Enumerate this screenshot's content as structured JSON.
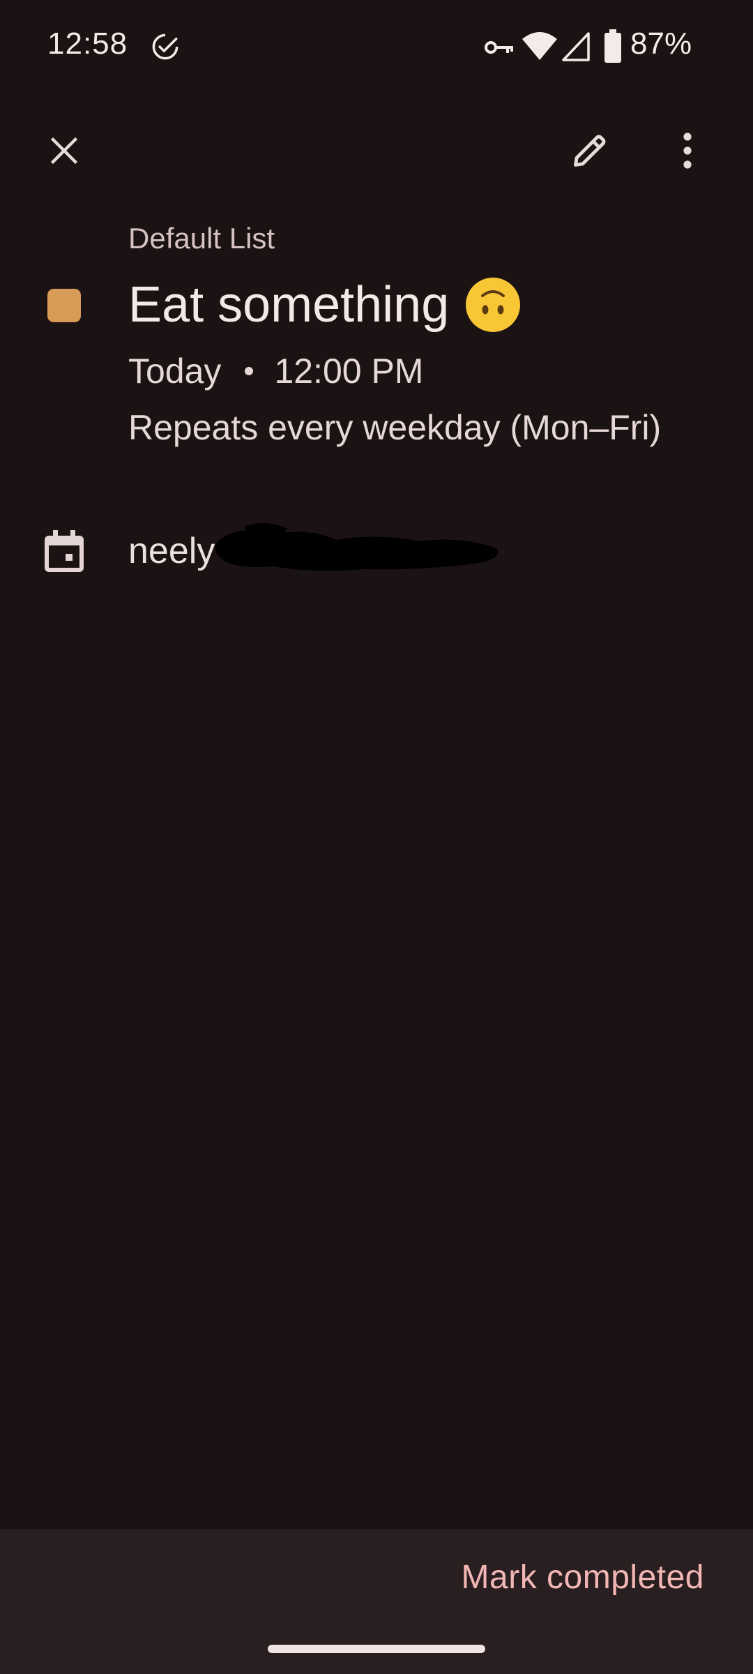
{
  "status_bar": {
    "time": "12:58",
    "battery": "87%"
  },
  "app_bar": {
    "close_icon": "close-icon",
    "edit_icon": "pencil-icon",
    "more_icon": "more-vert-icon"
  },
  "task": {
    "list_name": "Default List",
    "title": "Eat something",
    "title_emoji": "upside-down-face",
    "list_color": "#d89a57",
    "due_date": "Today",
    "due_time": "12:00 PM",
    "repeat": "Repeats every weekday (Mon–Fri)",
    "account_visible": "neely"
  },
  "footer": {
    "mark_completed_label": "Mark completed",
    "accent_color": "#f2b7b5"
  }
}
